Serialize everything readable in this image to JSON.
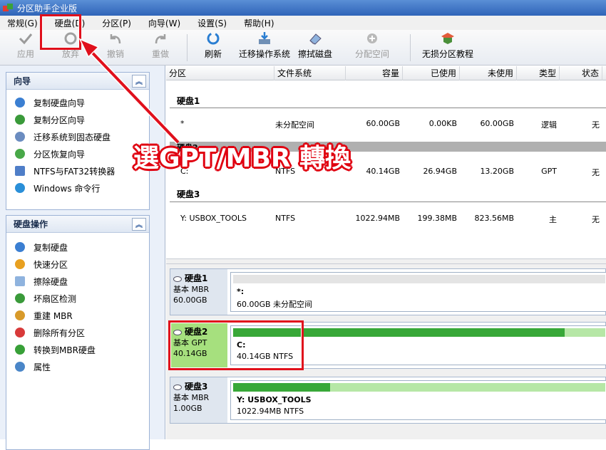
{
  "window": {
    "title": "分区助手企业版"
  },
  "menu": [
    {
      "label": "常规(G)"
    },
    {
      "label": "硬盘(D)"
    },
    {
      "label": "分区(P)"
    },
    {
      "label": "向导(W)"
    },
    {
      "label": "设置(S)"
    },
    {
      "label": "帮助(H)"
    }
  ],
  "toolbar": {
    "apply": "应用",
    "discard": "放弃",
    "undo": "撤销",
    "redo": "重做",
    "refresh": "刷新",
    "migrate": "迁移操作系统",
    "wipe": "擦拭磁盘",
    "allocate": "分配空间",
    "tutorial": "无损分区教程"
  },
  "wizard_panel": {
    "title": "向导",
    "items": [
      {
        "label": "复制硬盘向导"
      },
      {
        "label": "复制分区向导"
      },
      {
        "label": "迁移系统到固态硬盘"
      },
      {
        "label": "分区恢复向导"
      },
      {
        "label": "NTFS与FAT32转换器"
      },
      {
        "label": "Windows 命令行"
      }
    ]
  },
  "disk_ops_panel": {
    "title": "硬盘操作",
    "items": [
      {
        "label": "复制硬盘"
      },
      {
        "label": "快速分区"
      },
      {
        "label": "擦除硬盘"
      },
      {
        "label": "坏扇区检测"
      },
      {
        "label": "重建 MBR"
      },
      {
        "label": "删除所有分区"
      },
      {
        "label": "转换到MBR硬盘"
      },
      {
        "label": "属性"
      }
    ]
  },
  "table": {
    "headers": [
      "分区",
      "文件系统",
      "容量",
      "已使用",
      "未使用",
      "类型",
      "状态"
    ],
    "disks": [
      {
        "label": "硬盘1",
        "row": {
          "partition": "*",
          "fs": "未分配空间",
          "capacity": "60.00GB",
          "used": "0.00KB",
          "free": "60.00GB",
          "type": "逻辑",
          "status": "无"
        }
      },
      {
        "label": "硬盘2",
        "row": {
          "partition": "C:",
          "fs": "NTFS",
          "capacity": "40.14GB",
          "used": "26.94GB",
          "free": "13.20GB",
          "type": "GPT",
          "status": "无"
        }
      },
      {
        "label": "硬盘3",
        "row": {
          "partition": "Y: USBOX_TOOLS",
          "fs": "NTFS",
          "capacity": "1022.94MB",
          "used": "199.38MB",
          "free": "823.56MB",
          "type": "主",
          "status": "无"
        }
      }
    ]
  },
  "disk_map": [
    {
      "name": "硬盘1",
      "style": "基本 MBR",
      "size": "60.00GB",
      "part_label": "*:",
      "part_detail": "60.00GB 未分配空间",
      "used_fraction": 0.0
    },
    {
      "name": "硬盘2",
      "style": "基本 GPT",
      "size": "40.14GB",
      "part_label": "C:",
      "part_detail": "40.14GB NTFS",
      "used_fraction": 0.89
    },
    {
      "name": "硬盘3",
      "style": "基本 MBR",
      "size": "1.00GB",
      "part_label": "Y: USBOX_TOOLS",
      "part_detail": "1022.94MB NTFS",
      "used_fraction": 0.26
    }
  ],
  "annotation": {
    "text": "選GPT/MBR 轉換"
  },
  "colors": {
    "highlight": "#e0101c",
    "usage_fill": "#38a838",
    "selected_disk": "#a6e07e"
  }
}
